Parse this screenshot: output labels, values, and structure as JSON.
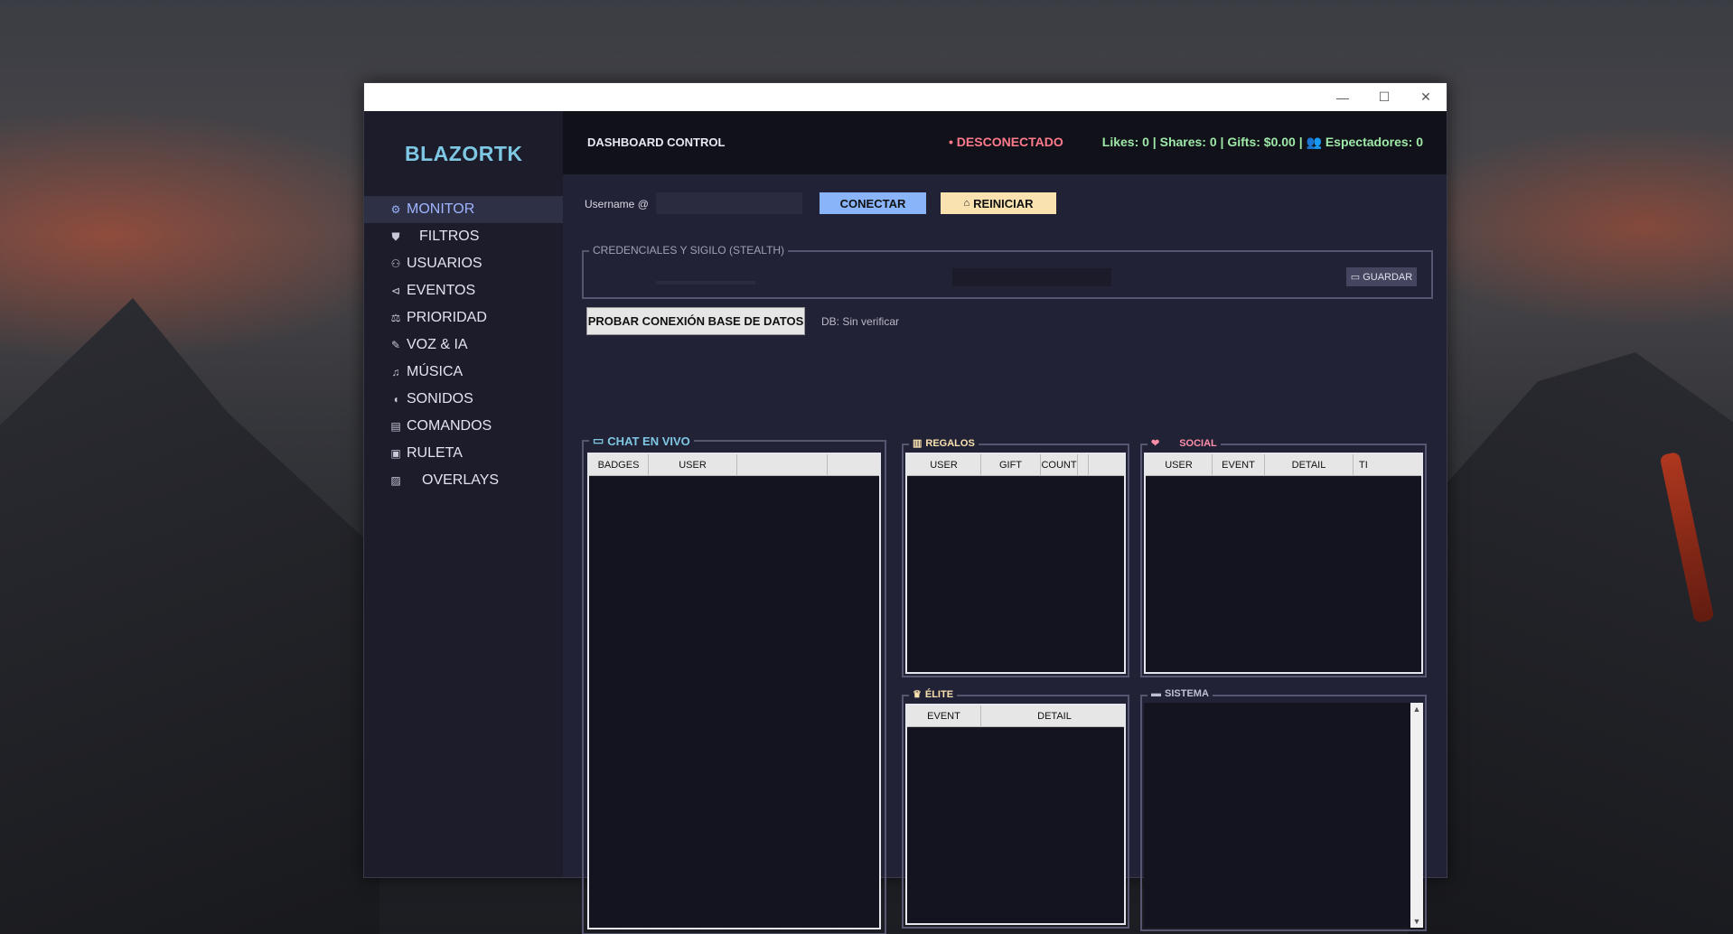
{
  "window": {
    "controls": {
      "minimize": "—",
      "maximize": "☐",
      "close": "✕"
    }
  },
  "sidebar": {
    "brand": "BLAZORTK",
    "items": [
      {
        "label": "MONITOR",
        "icon": "⚙",
        "active": true
      },
      {
        "label": "FILTROS",
        "icon": "⛊"
      },
      {
        "label": "USUARIOS",
        "icon": "⚇"
      },
      {
        "label": "EVENTOS",
        "icon": "⊲"
      },
      {
        "label": "PRIORIDAD",
        "icon": "⚖"
      },
      {
        "label": "VOZ & IA",
        "icon": "✎"
      },
      {
        "label": "MÚSICA",
        "icon": "♫"
      },
      {
        "label": "SONIDOS",
        "icon": "◖"
      },
      {
        "label": "COMANDOS",
        "icon": "▤"
      },
      {
        "label": "RULETA",
        "icon": "▣"
      },
      {
        "label": "OVERLAYS",
        "icon": "▨"
      }
    ]
  },
  "header": {
    "title": "DASHBOARD CONTROL",
    "status": "• DESCONECTADO",
    "stats": "Likes: 0 | Shares: 0 | Gifts: $0.00 | 👥 Espectadores: 0",
    "status_color": "#ff7a8a",
    "stats_color": "#9ee8a8"
  },
  "connect": {
    "username_label": "Username @",
    "username_value": "",
    "connect_label": "CONECTAR",
    "restart_label": "REINICIAR",
    "restart_icon": "⌂"
  },
  "credentials": {
    "legend": "CREDENCIALES Y SIGILO (STEALTH)",
    "save_label": "GUARDAR",
    "save_icon": "▭"
  },
  "db": {
    "test_label": "PROBAR CONEXIÓN BASE DE DATOS",
    "status": "DB: Sin verificar"
  },
  "chat": {
    "legend": "CHAT EN VIVO",
    "icon": "▭",
    "columns": [
      "BADGES",
      "USER",
      ""
    ]
  },
  "regalos": {
    "legend": "REGALOS",
    "icon": "▥",
    "columns": [
      "USER",
      "GIFT",
      "COUNT",
      ""
    ]
  },
  "social": {
    "legend": "SOCIAL",
    "icon": "❤",
    "columns": [
      "USER",
      "EVENT",
      "DETAIL",
      "TI"
    ]
  },
  "elite": {
    "legend": "ÉLITE",
    "icon": "♛",
    "columns": [
      "EVENT",
      "DETAIL"
    ]
  },
  "sistema": {
    "legend": "SISTEMA",
    "icon": "▬",
    "scroll_up": "▲",
    "scroll_down": "▼"
  }
}
